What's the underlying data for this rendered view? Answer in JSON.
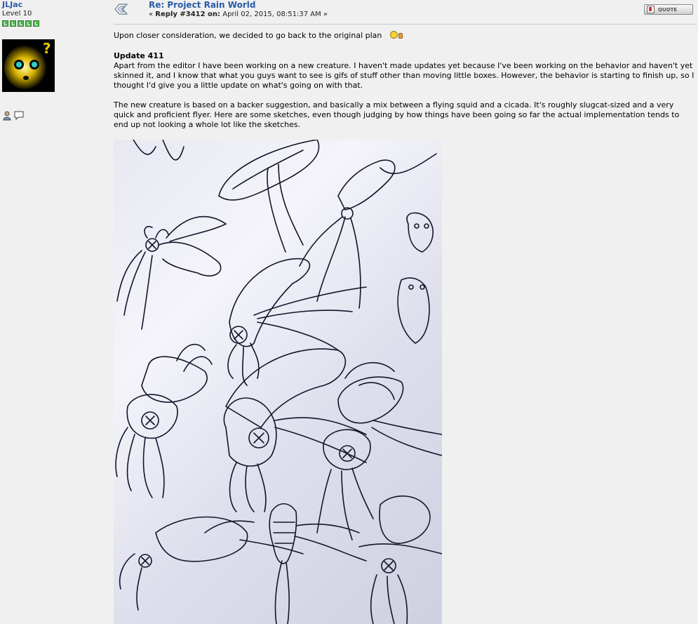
{
  "poster": {
    "name": "JLJac",
    "level": "Level 10",
    "star_count": 5
  },
  "post": {
    "title": "Re: Project Rain World",
    "meta_prefix": "« ",
    "meta_reply": "Reply #3412 on:",
    "meta_date": " April 02, 2015, 08:51:37 AM »",
    "quote_label": "QUOTE",
    "line1": "Upon closer consideration, we decided to go back to the original plan",
    "update_heading": "Update 411",
    "paragraph1": "Apart from the editor I have been working on a new creature. I haven't made updates yet because I've been working on the behavior and haven't yet skinned it, and I know that what you guys want to see is gifs of stuff other than moving little boxes. However, the behavior is starting to finish up, so I thought I'd give you a little update on what's going on with that.",
    "paragraph2": "The new creature is based on a backer suggestion, and basically a mix between a flying squid and a cicada. It's roughly slugcat-sized and a very quick and proficient flyer. Here are some sketches, even though judging by how things have been going so far the actual implementation tends to end up not looking a whole lot like the sketches."
  },
  "colors": {
    "link": "#2a5aa8",
    "background": "#f0f0f0",
    "star_green": "#5ab55a"
  },
  "icons": [
    "post-icon",
    "profile-icon",
    "message-icon",
    "quote-icon",
    "smiley-icon",
    "thumbs-up-icon"
  ]
}
